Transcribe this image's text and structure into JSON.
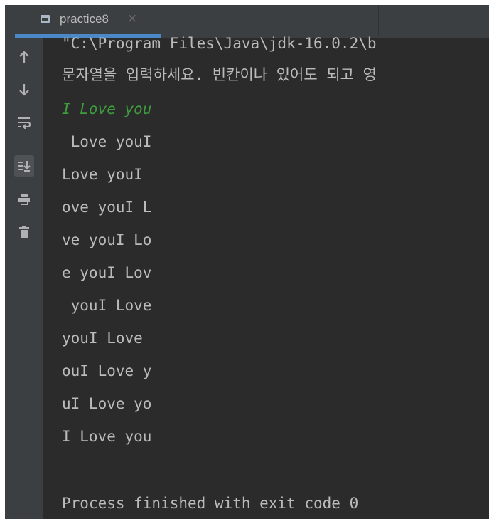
{
  "tab": {
    "label": "practice8",
    "close": "×"
  },
  "toolbar": {
    "up": "up-arrow-icon",
    "down": "down-arrow-icon",
    "wrap": "soft-wrap-icon",
    "scroll": "scroll-to-end-icon",
    "print": "print-icon",
    "trash": "trash-icon"
  },
  "console": {
    "lines": [
      "\"C:\\Program Files\\Java\\jdk-16.0.2\\b",
      "문자열을 입력하세요. 빈칸이나 있어도 되고 영",
      "I Love you",
      " Love youI",
      "Love youI ",
      "ove youI L",
      "ve youI Lo",
      "e youI Lov",
      " youI Love",
      "youI Love ",
      "ouI Love y",
      "uI Love yo",
      "I Love you",
      "",
      "Process finished with exit code 0"
    ]
  },
  "colors": {
    "background": "#2b2b2b",
    "panel": "#3c3f41",
    "text": "#bbbbbb",
    "input_text": "#3d9d3d",
    "tab_accent": "#4a88c7"
  }
}
